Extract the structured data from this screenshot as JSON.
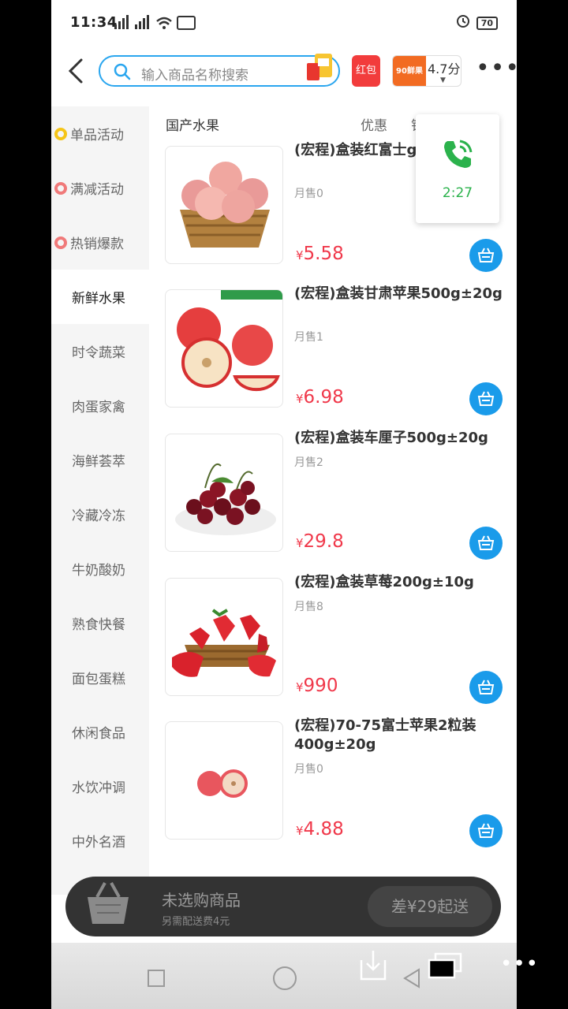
{
  "status_bar": {
    "time": "11:34",
    "signal": "\tull ull",
    "hd": "HD",
    "battery": "70"
  },
  "search": {
    "placeholder": "输入商品名称搜索"
  },
  "nav": {
    "hongbao_label": "红包",
    "rating": "4.7分",
    "rating_logo": "90鲜果"
  },
  "sidebar": {
    "items": [
      {
        "label": "单品活动",
        "dot_color": "#f5c518"
      },
      {
        "label": "满减活动",
        "dot_color": "#f07a7a"
      },
      {
        "label": "热销爆款",
        "dot_color": "#f07a7a"
      },
      {
        "label": "新鲜水果"
      },
      {
        "label": "时令蔬菜"
      },
      {
        "label": "肉蛋家禽"
      },
      {
        "label": "海鲜荟萃"
      },
      {
        "label": "冷藏冷冻"
      },
      {
        "label": "牛奶酸奶"
      },
      {
        "label": "熟食快餐"
      },
      {
        "label": "面包蛋糕"
      },
      {
        "label": "休闲食品"
      },
      {
        "label": "水饮冲调"
      },
      {
        "label": "中外名酒"
      }
    ]
  },
  "content": {
    "category_header": "国产水果",
    "filter_discount": "优惠",
    "filter_sales": "销"
  },
  "products": [
    {
      "name": "(宏程)盒装红富士g±20g",
      "sales": "月售0",
      "currency": "¥",
      "price": "5.58"
    },
    {
      "name": "(宏程)盒装甘肃苹果500g±20g",
      "sales": "月售1",
      "currency": "¥",
      "price": "6.98"
    },
    {
      "name": "(宏程)盒装车厘子500g±20g",
      "sales": "月售2",
      "currency": "¥",
      "price": "29.8"
    },
    {
      "name": "(宏程)盒装草莓200g±10g",
      "sales": "月售8",
      "currency": "¥",
      "price": "990"
    },
    {
      "name": "(宏程)70-75富士苹果2粒装400g±20g",
      "sales": "月售0",
      "currency": "¥",
      "price": "4.88"
    }
  ],
  "call_widget": {
    "timer": "2:27",
    "icon": "phone-call-icon"
  },
  "cart_bar": {
    "empty_label": "未选购商品",
    "delivery_fee": "另需配送费4元",
    "min_order": "差¥29起送"
  },
  "colors": {
    "accent": "#1a9bea",
    "price": "#f0384a",
    "call_green": "#2bb24c"
  }
}
